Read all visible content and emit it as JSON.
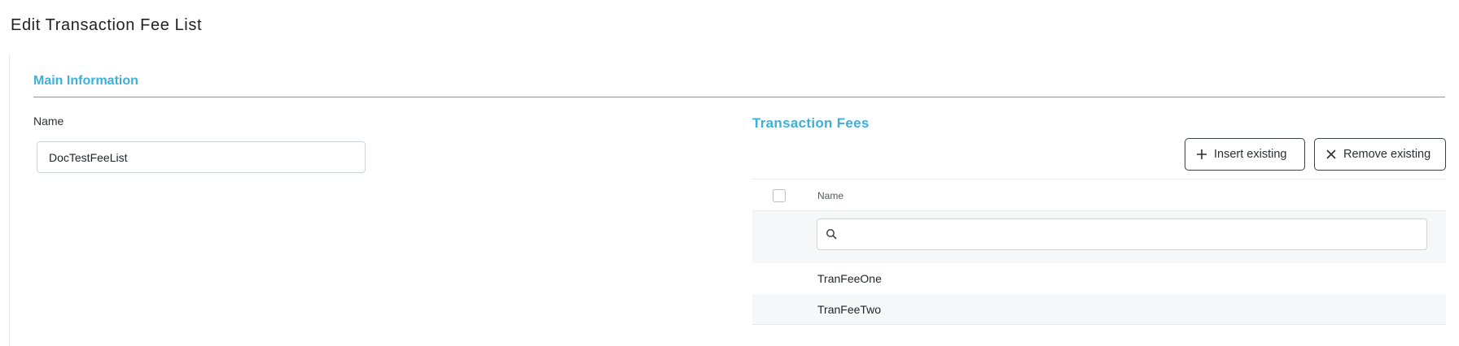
{
  "page": {
    "title": "Edit Transaction Fee List"
  },
  "main_info": {
    "section_title": "Main Information",
    "name_label": "Name",
    "name_value": "DocTestFeeList"
  },
  "transaction_fees": {
    "title": "Transaction Fees",
    "insert_label": "Insert existing",
    "remove_label": "Remove existing",
    "column_name": "Name",
    "filter_value": "",
    "rows": [
      {
        "name": "TranFeeOne"
      },
      {
        "name": "TranFeeTwo"
      }
    ]
  },
  "colors": {
    "accent": "#3cb0d9",
    "border": "#cfd4d9",
    "row_alt": "#f6f7f8"
  },
  "icons": {
    "insert": "plus-icon",
    "remove": "close-icon",
    "filter": "search-icon"
  }
}
